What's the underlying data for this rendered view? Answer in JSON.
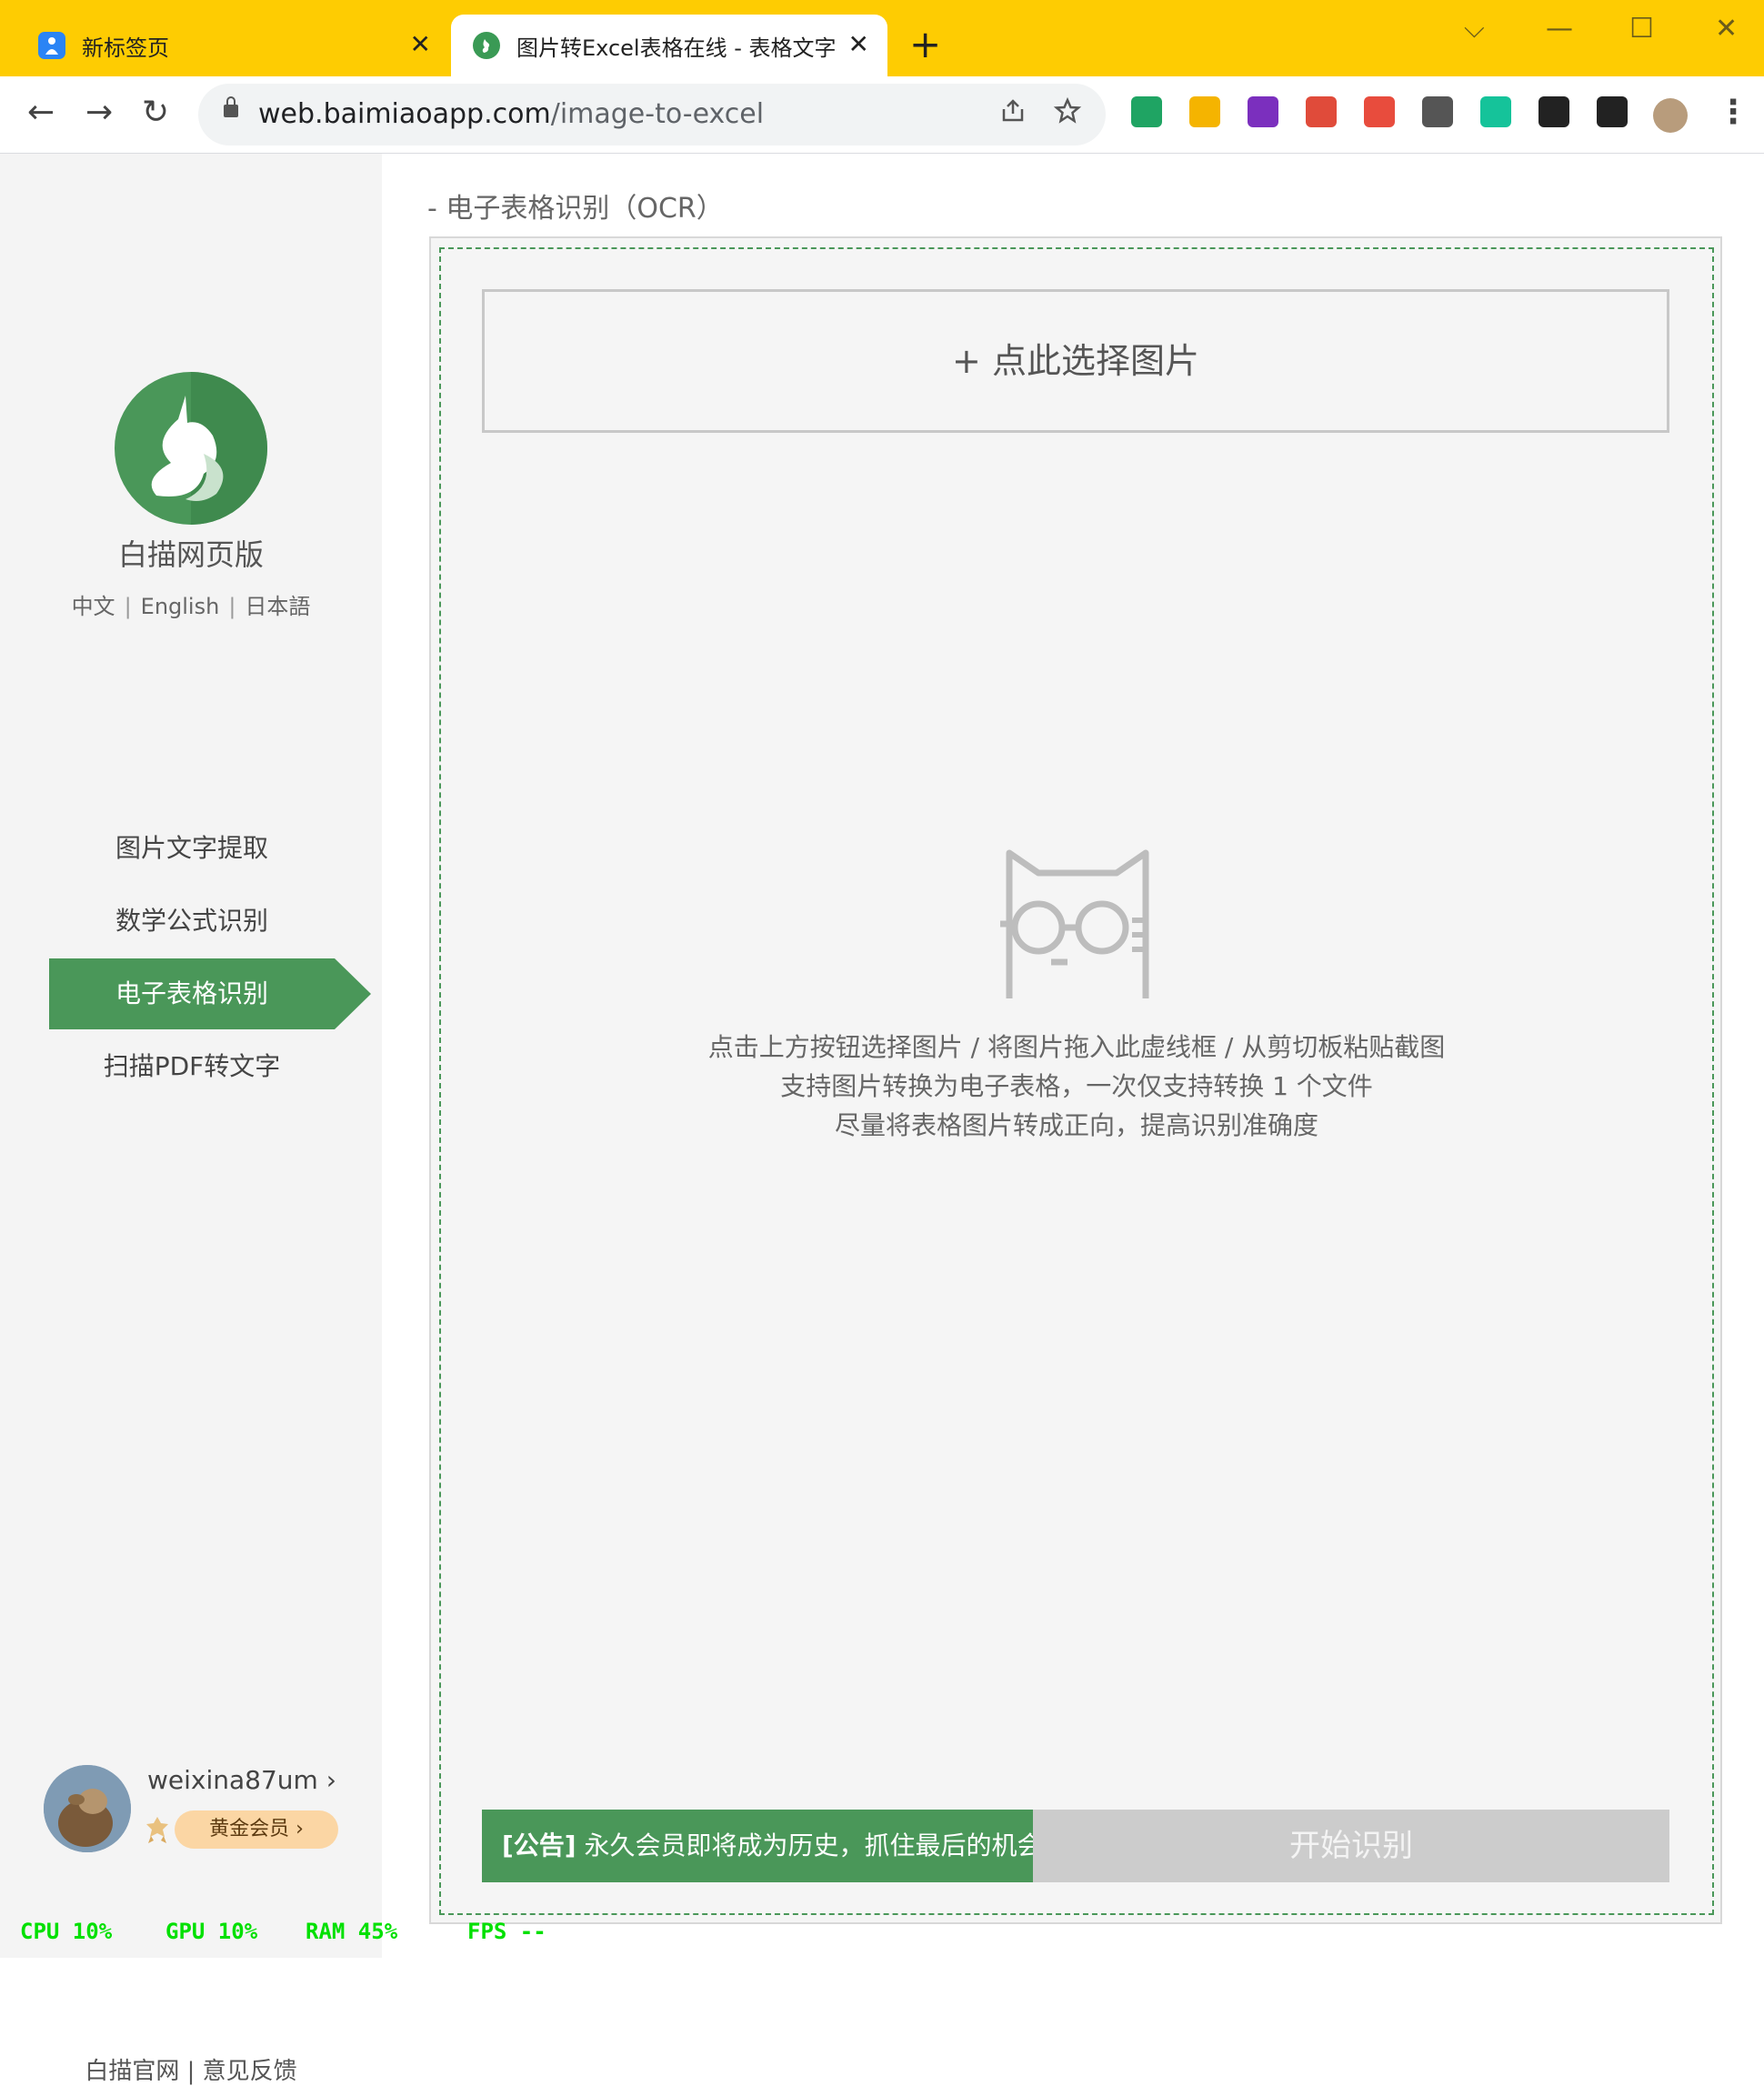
{
  "browser": {
    "tabs": [
      {
        "title": "新标签页"
      },
      {
        "title": "图片转Excel表格在线 - 表格文字"
      }
    ],
    "tab_close": "✕",
    "new_tab": "+",
    "window_controls": {
      "dropdown": "⌵",
      "minimize": "—",
      "maximize": "☐",
      "close": "✕"
    },
    "nav": {
      "back": "←",
      "forward": "→",
      "reload": "↻"
    },
    "url_domain": "web.baimiaoapp.com",
    "url_path": "/image-to-excel",
    "extensions": [
      {
        "name": "google-drive-icon",
        "color": "#1fa463"
      },
      {
        "name": "download-icon",
        "color": "#f5b400"
      },
      {
        "name": "onenote-icon",
        "color": "#7b2fbe"
      },
      {
        "name": "bowl-icon",
        "color": "#e04b3a"
      },
      {
        "name": "list-icon",
        "color": "#e84c3d"
      },
      {
        "name": "z-icon",
        "color": "#555555"
      },
      {
        "name": "grammarly-icon",
        "color": "#15c39a"
      },
      {
        "name": "puzzle-icon",
        "color": "#222222"
      },
      {
        "name": "sidepanel-icon",
        "color": "#222222"
      }
    ],
    "menu": "⋮"
  },
  "sidebar": {
    "brand": "白描网页版",
    "languages": [
      "中文",
      "English",
      "日本語"
    ],
    "lang_sep": "|",
    "menu": [
      {
        "label": "图片文字提取",
        "active": false
      },
      {
        "label": "数学公式识别",
        "active": false
      },
      {
        "label": "电子表格识别",
        "active": true
      },
      {
        "label": "扫描PDF转文字",
        "active": false
      }
    ],
    "user": {
      "name": "weixina87um",
      "membership": "黄金会员"
    },
    "footer_links": "白描官网 | 意见反馈"
  },
  "main": {
    "section_title": "- 电子表格识别（OCR）",
    "choose_button": "+ 点此选择图片",
    "hints": [
      "点击上方按钮选择图片 / 将图片拖入此虚线框 / 从剪切板粘贴截图",
      "支持图片转换为电子表格，一次仅支持转换 1 个文件",
      "尽量将表格图片转成正向，提高识别准确度"
    ],
    "notice_tag": "[公告]",
    "notice_text": " 永久会员即将成为历史，抓住最后的机会",
    "start_button": "开始识别"
  },
  "perf_overlay": {
    "cpu": "CPU  10%",
    "gpu": "GPU  10%",
    "ram": "RAM  45%",
    "fps": "FPS --"
  },
  "colors": {
    "tabbar": "#fecc02",
    "accent_green": "#4a9759",
    "start_disabled": "#cccccc"
  }
}
